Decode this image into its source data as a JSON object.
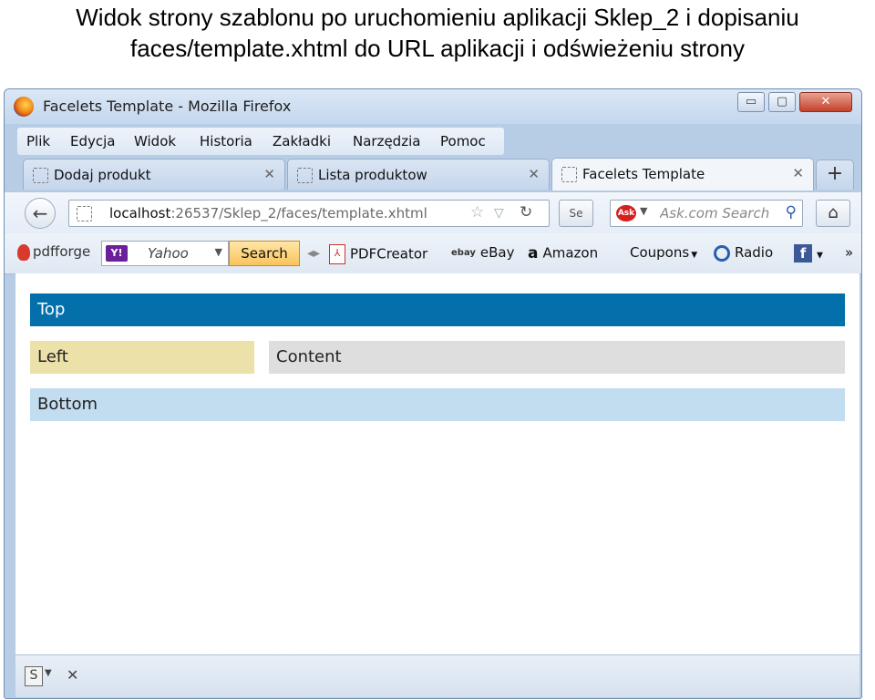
{
  "caption": {
    "line1": "Widok strony szablonu po uruchomieniu aplikacji Sklep_2 i dopisaniu",
    "line2": "faces/template.xhtml do URL aplikacji i odświeżeniu strony"
  },
  "window": {
    "title": "Facelets Template - Mozilla Firefox",
    "controls": {
      "minimize": "▭",
      "maximize": "▢",
      "close": "✕"
    }
  },
  "menu": [
    "Plik",
    "Edycja",
    "Widok",
    "Historia",
    "Zakładki",
    "Narzędzia",
    "Pomoc"
  ],
  "tabs": [
    {
      "label": "Dodaj produkt",
      "active": false
    },
    {
      "label": "Lista produktow",
      "active": false
    },
    {
      "label": "Facelets Template",
      "active": true
    }
  ],
  "tab_close": "✕",
  "new_tab": "+",
  "nav": {
    "back": "←",
    "url_host": "localhost",
    "url_rest": ":26537/Sklep_2/faces/template.xhtml",
    "star": "☆",
    "dropdown": "▽",
    "reload": "↻",
    "search_placeholder": "Ask.com Search",
    "ask_label": "Ask",
    "home": "⌂"
  },
  "toolbar": {
    "pdfforge": "pdfforge",
    "yahoo_logo": "Y!",
    "yahoo_text": "Yahoo",
    "search_button": "Search",
    "items": [
      "PDFCreator",
      "eBay",
      "Amazon",
      "Coupons",
      "Radio"
    ],
    "ebay_icon": "ebay",
    "amazon_icon": "a",
    "pdf_icon": "⅄",
    "fb_icon": "f",
    "more": "»"
  },
  "page": {
    "top": "Top",
    "left": "Left",
    "content": "Content",
    "bottom": "Bottom"
  },
  "status": {
    "s": "S",
    "close": "✕"
  }
}
